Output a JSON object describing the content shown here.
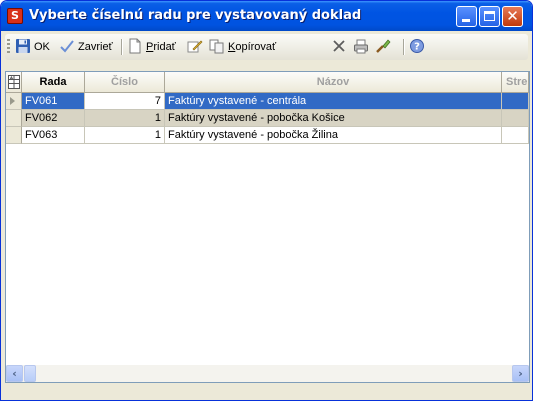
{
  "window": {
    "title": "Vyberte číselnú radu pre vystavovaný doklad",
    "app_icon_text": "S"
  },
  "toolbar": {
    "ok_label": "OK",
    "close_label": "Zavrieť",
    "add_label_underlined": "P",
    "add_label_rest": "ridať",
    "copy_label_underlined": "K",
    "copy_label_rest": "opírovať"
  },
  "grid": {
    "corner_icon": "grid-settings-icon",
    "columns": [
      "Rada",
      "Číslo",
      "Názov",
      "Stre"
    ],
    "rows": [
      {
        "rada": "FV061",
        "cislo": "7",
        "nazov": "Faktúry vystavené - centrála"
      },
      {
        "rada": "FV062",
        "cislo": "1",
        "nazov": "Faktúry vystavené - pobočka Košice"
      },
      {
        "rada": "FV063",
        "cislo": "1",
        "nazov": "Faktúry vystavené - pobočka Žilina"
      }
    ]
  },
  "colors": {
    "titlebar": "#0054e3",
    "selection": "#316ac5",
    "alt_row": "#d8d4c4",
    "face": "#ece9d8"
  }
}
